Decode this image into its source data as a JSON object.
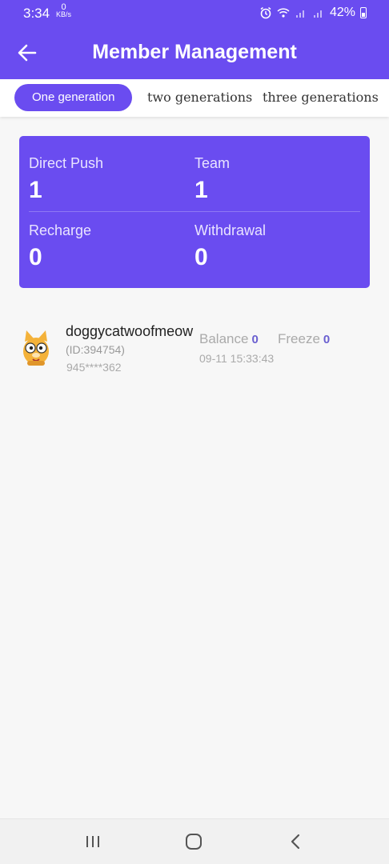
{
  "status_bar": {
    "time": "3:34",
    "kbps_value": "0",
    "kbps_unit": "KB/s",
    "battery": "42%"
  },
  "header": {
    "title": "Member Management",
    "back_icon": "arrow-left-icon"
  },
  "tabs": [
    {
      "label": "One generation",
      "active": true
    },
    {
      "label": "two generations",
      "active": false
    },
    {
      "label": "three generations",
      "active": false
    }
  ],
  "stats": {
    "direct_push_label": "Direct Push",
    "direct_push_value": "1",
    "team_label": "Team",
    "team_value": "1",
    "recharge_label": "Recharge",
    "recharge_value": "0",
    "withdrawal_label": "Withdrawal",
    "withdrawal_value": "0"
  },
  "members": [
    {
      "name": "doggycatwoofmeow",
      "id_text": "(ID:394754)",
      "phone": "945****362",
      "balance_label": "Balance",
      "balance_value": "0",
      "freeze_label": "Freeze",
      "freeze_value": "0",
      "date": "09-11 15:33:43"
    }
  ],
  "colors": {
    "accent": "#6a4cf0",
    "value_color": "#6a5fd0"
  }
}
